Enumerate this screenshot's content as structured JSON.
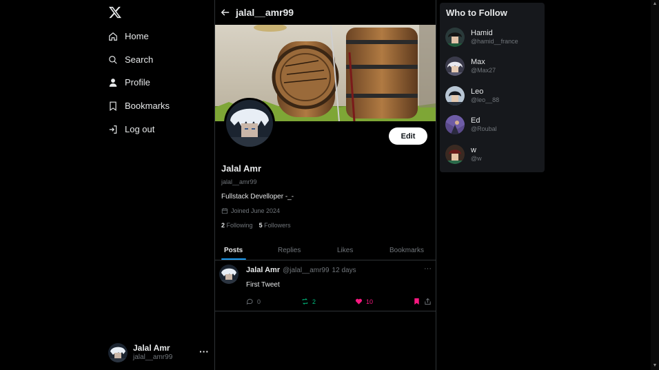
{
  "nav": {
    "items": [
      {
        "label": "Home",
        "icon": "home-icon"
      },
      {
        "label": "Search",
        "icon": "search-icon"
      },
      {
        "label": "Profile",
        "icon": "user-icon"
      },
      {
        "label": "Bookmarks",
        "icon": "bookmark-icon"
      },
      {
        "label": "Log out",
        "icon": "logout-icon"
      }
    ]
  },
  "account": {
    "name": "Jalal Amr",
    "handle": "jalal__amr99",
    "more": "···"
  },
  "header": {
    "title": "jalal__amr99"
  },
  "profile": {
    "edit_label": "Edit",
    "name": "Jalal Amr",
    "handle": "jalal__amr99",
    "bio": "Fullstack Develloper -_-",
    "joined": "Joined June 2024",
    "following_count": "2",
    "following_label": "Following",
    "followers_count": "5",
    "followers_label": "Followers"
  },
  "tabs": [
    {
      "label": "Posts",
      "active": true
    },
    {
      "label": "Replies",
      "active": false
    },
    {
      "label": "Likes",
      "active": false
    },
    {
      "label": "Bookmarks",
      "active": false
    }
  ],
  "tweet": {
    "name": "Jalal Amr",
    "handle": "@jalal__amr99",
    "time": "12 days",
    "more": "···",
    "text": "First Tweet",
    "replies": "0",
    "retweets": "2",
    "likes": "10"
  },
  "who_to_follow": {
    "title": "Who to Follow",
    "users": [
      {
        "name": "Hamid",
        "handle": "@hamid__france"
      },
      {
        "name": "Max",
        "handle": "@Max27"
      },
      {
        "name": "Leo",
        "handle": "@leo__88"
      },
      {
        "name": "Ed",
        "handle": "@Roubal"
      },
      {
        "name": "w",
        "handle": "@w"
      }
    ]
  },
  "colors": {
    "background": "#000000",
    "panel": "#16181c",
    "accent": "#1d9bf0",
    "retweet": "#00ba7c",
    "like": "#f91880",
    "muted": "#71767b"
  }
}
